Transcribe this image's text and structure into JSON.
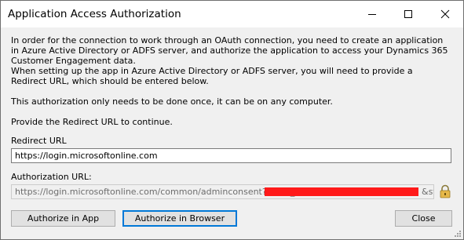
{
  "window": {
    "title": "Application Access Authorization",
    "controls": {
      "minimize": "minimize-icon",
      "maximize": "maximize-icon",
      "close": "close-icon"
    }
  },
  "content": {
    "paragraph1": "In order for the connection to work through an OAuth connection, you need to create an application in Azure Active Directory or ADFS server, and authorize the application to access your Dynamics 365 Customer Engagement data.",
    "paragraph2": "When setting up the app in Azure Active Directory or ADFS server, you will need to provide a Redirect URL, which should be entered below.",
    "paragraph3": "This authorization only needs to be done once, it can be on any computer.",
    "paragraph4": "Provide the Redirect URL to continue."
  },
  "redirect": {
    "label": "Redirect URL",
    "value": "https://login.microsoftonline.com"
  },
  "authorization": {
    "label": "Authorization URL:",
    "value_visible_start": "https://login.microsoftonline.com/common/adminconsent?client_id=",
    "value_visible_end": "&st",
    "redaction_color": "#ff1a1a",
    "lock_icon": "lock-icon"
  },
  "buttons": {
    "authorize_app": "Authorize in App",
    "authorize_browser": "Authorize in Browser",
    "close": "Close"
  },
  "colors": {
    "focus_border": "#0078d7",
    "button_bg": "#e1e1e1",
    "window_bg": "#f0f0f0"
  }
}
